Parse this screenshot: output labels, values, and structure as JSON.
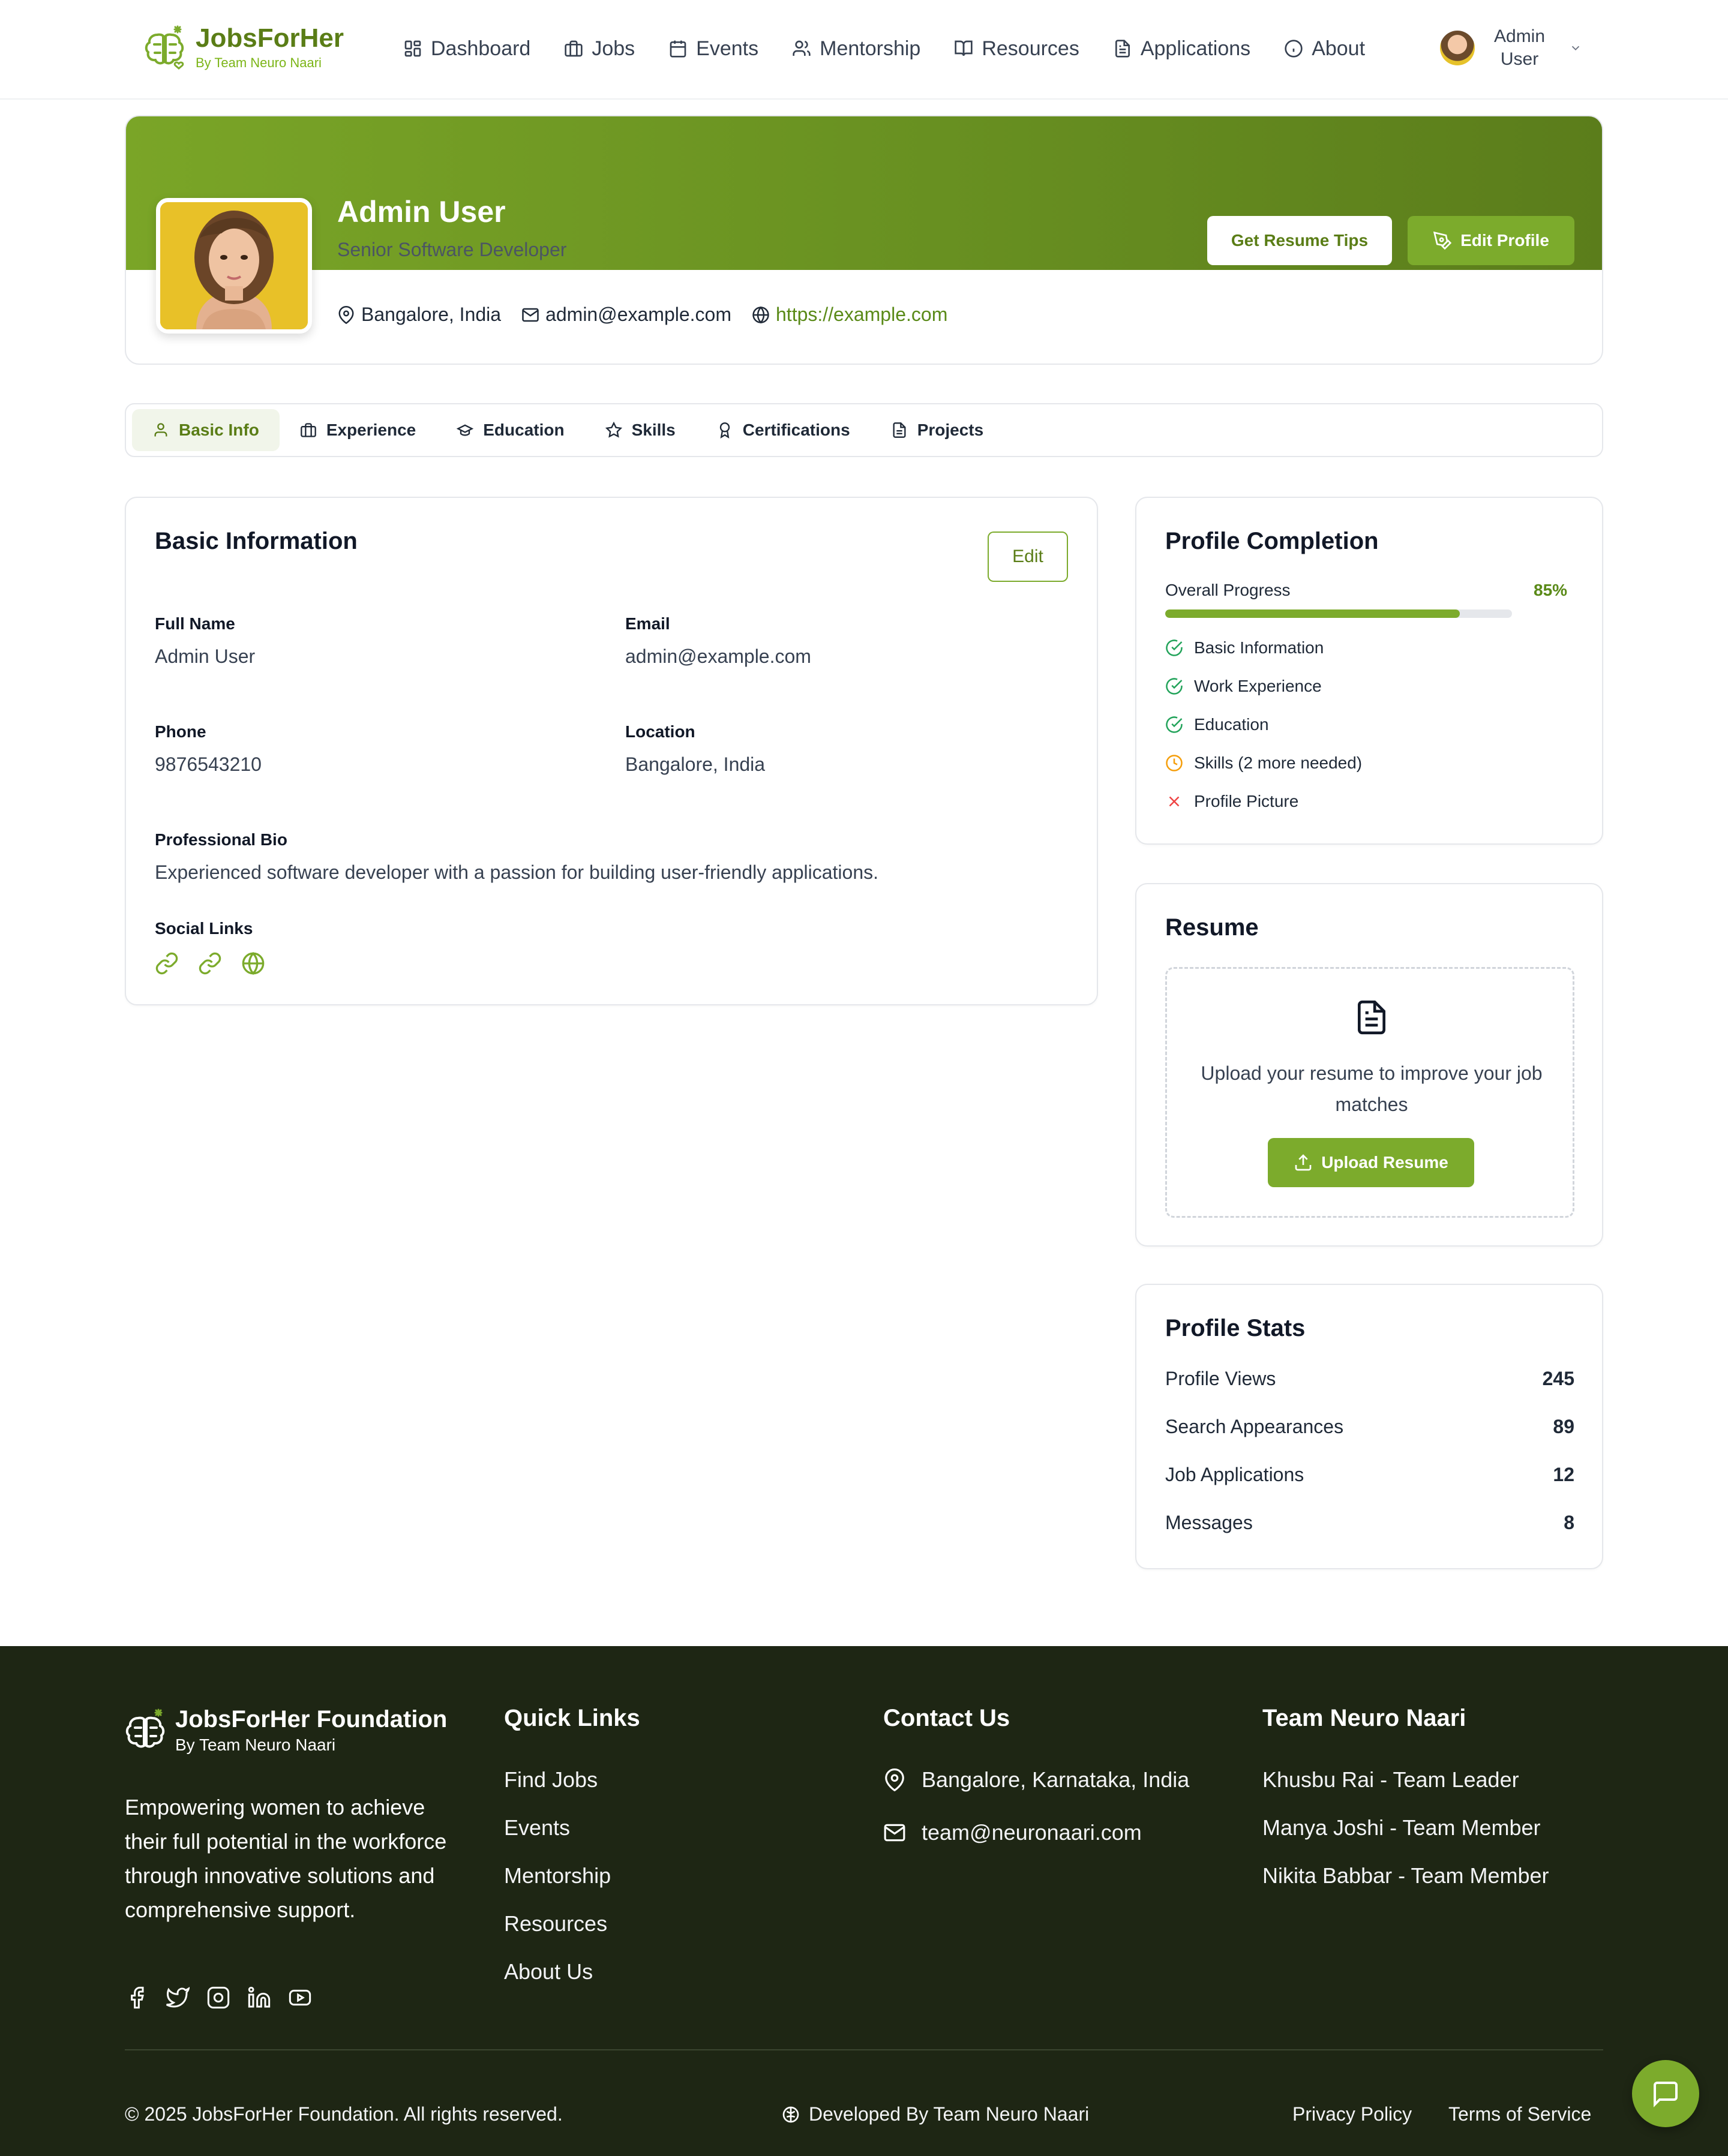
{
  "brand": {
    "name": "JobsForHer",
    "tagline": "By Team Neuro Naari"
  },
  "nav": {
    "items": [
      {
        "label": "Dashboard",
        "icon": "dashboard-icon"
      },
      {
        "label": "Jobs",
        "icon": "briefcase-icon"
      },
      {
        "label": "Events",
        "icon": "calendar-icon"
      },
      {
        "label": "Mentorship",
        "icon": "users-icon"
      },
      {
        "label": "Resources",
        "icon": "book-icon"
      },
      {
        "label": "Applications",
        "icon": "document-icon"
      },
      {
        "label": "About",
        "icon": "info-icon"
      }
    ],
    "user_line1": "Admin",
    "user_line2": "User"
  },
  "profile": {
    "name": "Admin User",
    "title": "Senior Software Developer",
    "location": "Bangalore, India",
    "email": "admin@example.com",
    "website": "https://example.com",
    "tips_button": "Get Resume Tips",
    "edit_button": "Edit Profile"
  },
  "tabs": [
    {
      "label": "Basic Info",
      "icon": "user-icon",
      "active": true
    },
    {
      "label": "Experience",
      "icon": "briefcase-icon",
      "active": false
    },
    {
      "label": "Education",
      "icon": "graduation-cap-icon",
      "active": false
    },
    {
      "label": "Skills",
      "icon": "star-icon",
      "active": false
    },
    {
      "label": "Certifications",
      "icon": "award-icon",
      "active": false
    },
    {
      "label": "Projects",
      "icon": "document-icon",
      "active": false
    }
  ],
  "basic_info": {
    "title": "Basic Information",
    "edit_label": "Edit",
    "full_name_label": "Full Name",
    "full_name": "Admin User",
    "email_label": "Email",
    "email": "admin@example.com",
    "phone_label": "Phone",
    "phone": "9876543210",
    "location_label": "Location",
    "location": "Bangalore, India",
    "bio_label": "Professional Bio",
    "bio": "Experienced software developer with a passion for building user-friendly applications.",
    "social_label": "Social Links"
  },
  "completion": {
    "title": "Profile Completion",
    "progress_label": "Overall Progress",
    "progress_text": "85%",
    "progress_value": 0.85,
    "items": [
      {
        "label": "Basic Information",
        "status": "done"
      },
      {
        "label": "Work Experience",
        "status": "done"
      },
      {
        "label": "Education",
        "status": "done"
      },
      {
        "label": "Skills (2 more needed)",
        "status": "pending"
      },
      {
        "label": "Profile Picture",
        "status": "missing"
      }
    ]
  },
  "resume": {
    "title": "Resume",
    "prompt": "Upload your resume to improve your job matches",
    "upload_button": "Upload Resume"
  },
  "stats": {
    "title": "Profile Stats",
    "rows": [
      {
        "label": "Profile Views",
        "value": "245"
      },
      {
        "label": "Search Appearances",
        "value": "89"
      },
      {
        "label": "Job Applications",
        "value": "12"
      },
      {
        "label": "Messages",
        "value": "8"
      }
    ]
  },
  "footer": {
    "brand_title": "JobsForHer Foundation",
    "brand_sub": "By Team Neuro Naari",
    "description": "Empowering women to achieve their full potential in the workforce through innovative solutions and comprehensive support.",
    "quick_links_title": "Quick Links",
    "quick_links": [
      "Find Jobs",
      "Events",
      "Mentorship",
      "Resources",
      "About Us"
    ],
    "contact_title": "Contact Us",
    "contact_address": "Bangalore, Karnataka, India",
    "contact_email": "team@neuronaari.com",
    "team_title": "Team Neuro Naari",
    "team": [
      "Khusbu Rai - Team Leader",
      "Manya Joshi - Team Member",
      "Nikita Babbar - Team Member"
    ],
    "copyright": "© 2025 JobsForHer Foundation. All rights reserved.",
    "developed_by": "Developed By Team Neuro Naari",
    "privacy": "Privacy Policy",
    "terms": "Terms of Service"
  },
  "colors": {
    "accent": "#7cab2c",
    "accent_dark": "#5a7d16",
    "footer_bg": "#1e2614",
    "pending": "#f59e0b",
    "missing": "#ef4444",
    "done": "#22a35a"
  }
}
